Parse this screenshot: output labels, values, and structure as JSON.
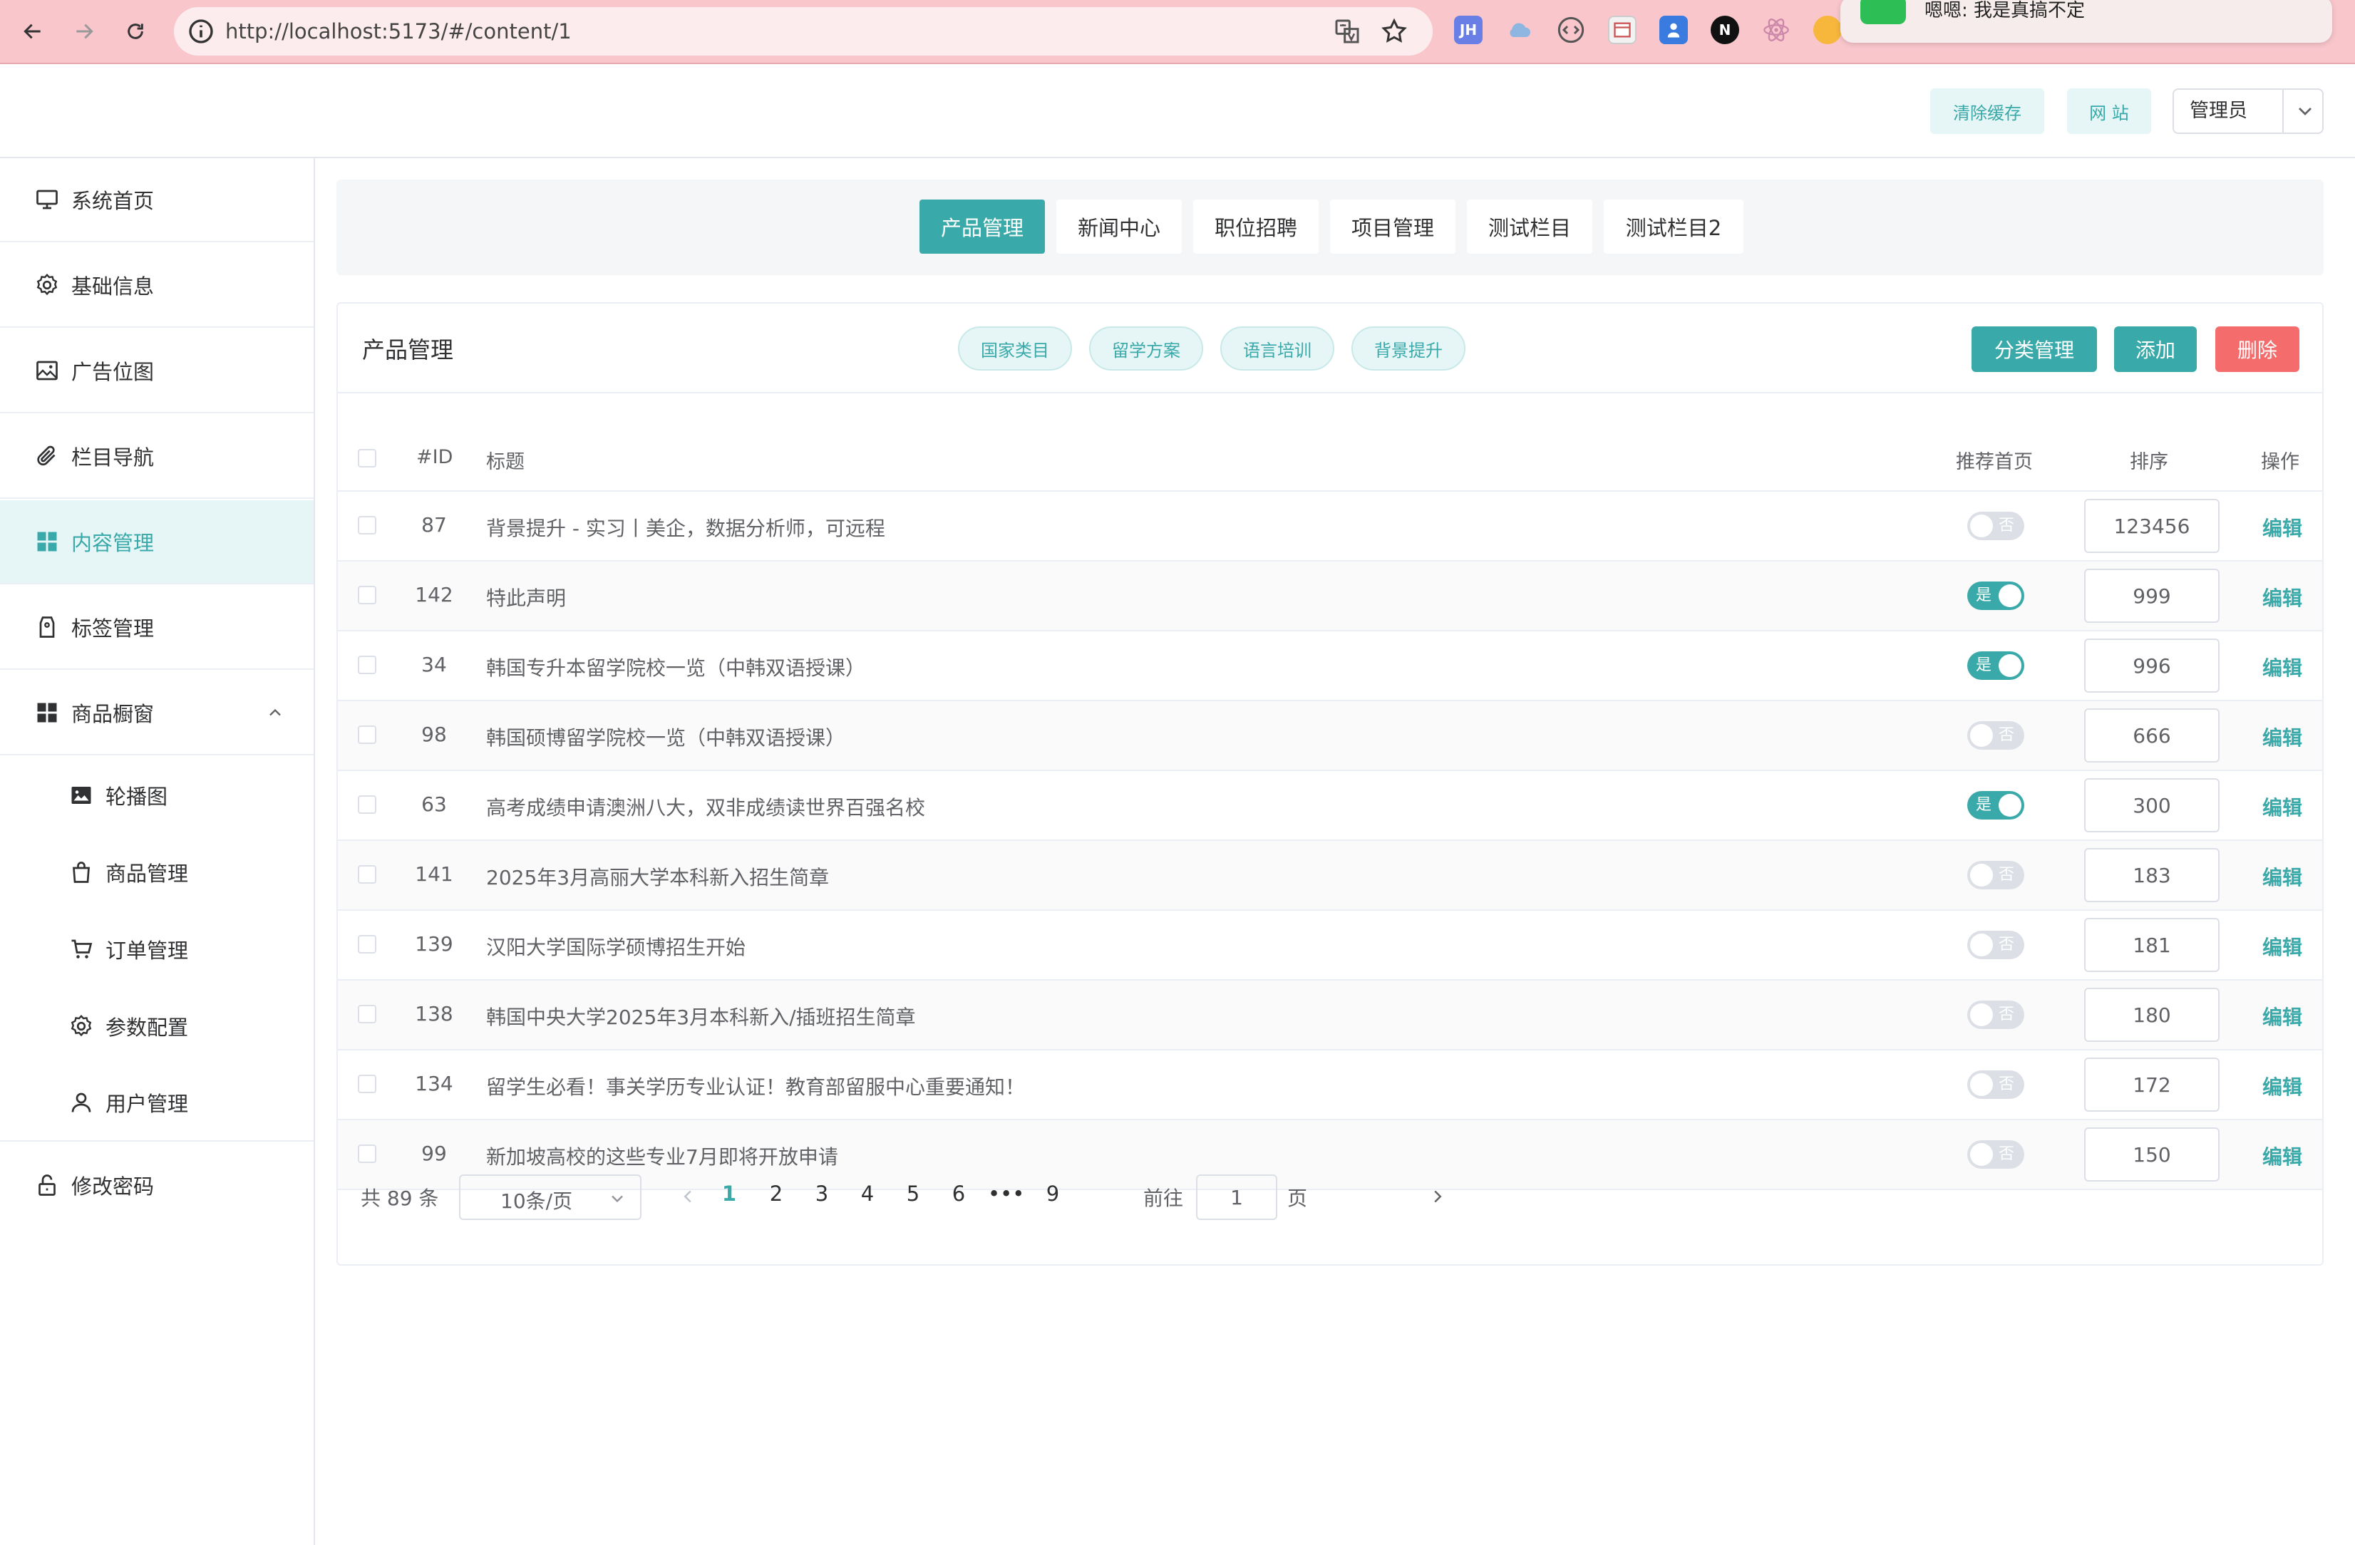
{
  "browser": {
    "url": "http://localhost:5173/#/content/1",
    "notification": "嗯嗯: 我是真搞不定"
  },
  "header": {
    "clear_cache": "清除缓存",
    "website": "网 站",
    "admin": "管理员"
  },
  "sidebar": {
    "items": [
      {
        "label": "系统首页",
        "icon": "monitor-icon"
      },
      {
        "label": "基础信息",
        "icon": "gear-icon"
      },
      {
        "label": "广告位图",
        "icon": "image-icon"
      },
      {
        "label": "栏目导航",
        "icon": "paperclip-icon"
      },
      {
        "label": "内容管理",
        "icon": "grid-icon",
        "active": true
      },
      {
        "label": "标签管理",
        "icon": "tag-icon"
      },
      {
        "label": "商品橱窗",
        "icon": "grid-icon",
        "expanded": true
      }
    ],
    "sub_items": [
      {
        "label": "轮播图",
        "icon": "picture-icon"
      },
      {
        "label": "商品管理",
        "icon": "bag-icon"
      },
      {
        "label": "订单管理",
        "icon": "cart-icon"
      },
      {
        "label": "参数配置",
        "icon": "gear-icon"
      },
      {
        "label": "用户管理",
        "icon": "user-icon"
      }
    ],
    "change_password": "修改密码"
  },
  "tabs": [
    "产品管理",
    "新闻中心",
    "职位招聘",
    "项目管理",
    "测试栏目",
    "测试栏目2"
  ],
  "active_tab": 0,
  "card": {
    "title": "产品管理",
    "chips": [
      "国家类目",
      "留学方案",
      "语言培训",
      "背景提升"
    ],
    "buttons": {
      "category": "分类管理",
      "add": "添加",
      "delete": "删除"
    }
  },
  "table": {
    "columns": {
      "id": "#ID",
      "title": "标题",
      "recommend": "推荐首页",
      "sort": "排序",
      "action": "操作"
    },
    "toggle_on": "是",
    "toggle_off": "否",
    "edit_label": "编辑",
    "rows": [
      {
        "id": "87",
        "title": "背景提升 - 实习丨美企，数据分析师，可远程",
        "recommend": false,
        "sort": "123456"
      },
      {
        "id": "142",
        "title": "特此声明",
        "recommend": true,
        "sort": "999"
      },
      {
        "id": "34",
        "title": "韩国专升本留学院校一览（中韩双语授课）",
        "recommend": true,
        "sort": "996"
      },
      {
        "id": "98",
        "title": "韩国硕博留学院校一览（中韩双语授课）",
        "recommend": false,
        "sort": "666"
      },
      {
        "id": "63",
        "title": "高考成绩申请澳洲八大，双非成绩读世界百强名校",
        "recommend": true,
        "sort": "300"
      },
      {
        "id": "141",
        "title": "2025年3月高丽大学本科新入招生简章",
        "recommend": false,
        "sort": "183"
      },
      {
        "id": "139",
        "title": "汉阳大学国际学硕博招生开始",
        "recommend": false,
        "sort": "181"
      },
      {
        "id": "138",
        "title": "韩国中央大学2025年3月本科新入/插班招生简章",
        "recommend": false,
        "sort": "180"
      },
      {
        "id": "134",
        "title": "留学生必看！事关学历专业认证！教育部留服中心重要通知！",
        "recommend": false,
        "sort": "172"
      },
      {
        "id": "99",
        "title": "新加坡高校的这些专业7月即将开放申请",
        "recommend": false,
        "sort": "150"
      }
    ]
  },
  "pagination": {
    "total": "共 89 条",
    "page_size": "10条/页",
    "pages": [
      "1",
      "2",
      "3",
      "4",
      "5",
      "6",
      "•••",
      "9"
    ],
    "current": "1",
    "goto_prefix": "前往",
    "goto_value": "1",
    "goto_suffix": "页"
  },
  "colors": {
    "accent": "#3aa9a9",
    "danger": "#f56c6c",
    "browser_bar": "#f9c6cc"
  }
}
